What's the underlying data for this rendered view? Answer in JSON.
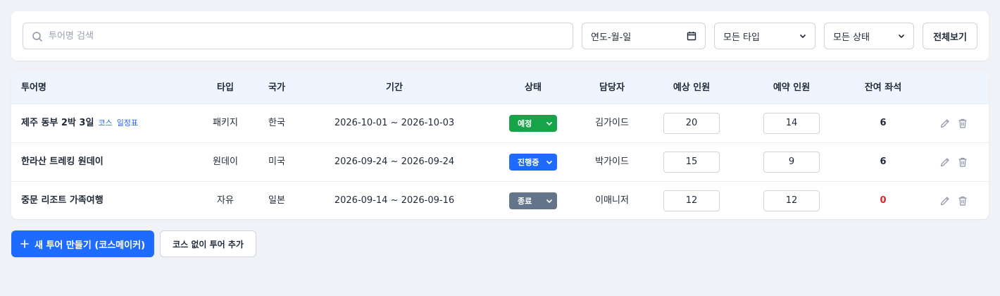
{
  "filters": {
    "search_placeholder": "투어명 검색",
    "date_placeholder": "연도-월-일",
    "type_select": "모든 타입",
    "status_select": "모든 상태",
    "view_all_label": "전체보기"
  },
  "table": {
    "headers": {
      "name": "투어명",
      "type": "타입",
      "country": "국가",
      "period": "기간",
      "status": "상태",
      "manager": "담당자",
      "expected": "예상 인원",
      "reserved": "예약 인원",
      "remaining": "잔여 좌석"
    },
    "rows": [
      {
        "name": "제주 동부 2박 3일",
        "course_link": "코스",
        "schedule_link": "일정표",
        "type": "패키지",
        "country": "한국",
        "period": "2026-10-01 ~ 2026-10-03",
        "status": "예정",
        "manager": "김가이드",
        "expected": "20",
        "reserved": "14",
        "remaining": "6"
      },
      {
        "name": "한라산 트레킹 원데이",
        "type": "원데이",
        "country": "미국",
        "period": "2026-09-24 ~ 2026-09-24",
        "status": "진행중",
        "manager": "박가이드",
        "expected": "15",
        "reserved": "9",
        "remaining": "6"
      },
      {
        "name": "중문 리조트 가족여행",
        "type": "자유",
        "country": "일본",
        "period": "2026-09-14 ~ 2026-09-16",
        "status": "종료",
        "manager": "이매니저",
        "expected": "12",
        "reserved": "12",
        "remaining": "0"
      }
    ]
  },
  "actions": {
    "create_tour_label": "새 투어 만들기 (코스메이커)",
    "add_without_course_label": "코스 없이 투어 추가"
  },
  "colors": {
    "primary": "#1f6bff",
    "status_scheduled": "#16a34a",
    "status_in_progress": "#1f6bff",
    "status_ended": "#64748b",
    "remaining_zero": "#dc2626",
    "header_bg": "#eef5ff"
  }
}
